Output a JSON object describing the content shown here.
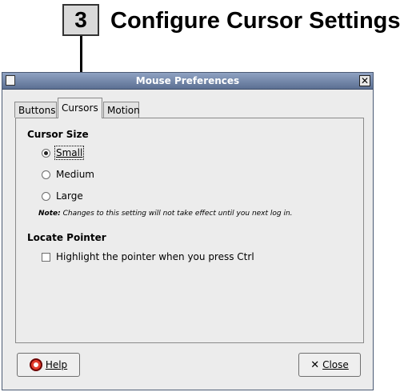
{
  "step": {
    "number": "3",
    "title": "Configure Cursor Settings"
  },
  "window": {
    "title": "Mouse Preferences",
    "close_glyph": "✕",
    "icon": "window-icon",
    "tabs": [
      {
        "label": "Buttons",
        "selected": false
      },
      {
        "label": "Cursors",
        "selected": true
      },
      {
        "label": "Motion",
        "selected": false
      }
    ],
    "cursor_size": {
      "title": "Cursor Size",
      "options": [
        {
          "label": "Small",
          "selected": true
        },
        {
          "label": "Medium",
          "selected": false
        },
        {
          "label": "Large",
          "selected": false
        }
      ],
      "note_label": "Note:",
      "note_text": "Changes to this setting will not take effect until you next log in."
    },
    "locate_pointer": {
      "title": "Locate Pointer",
      "checkbox_label": "Highlight the pointer when you press Ctrl",
      "checked": false
    },
    "buttons": {
      "help_label": "Help",
      "close_label": "Close"
    }
  }
}
